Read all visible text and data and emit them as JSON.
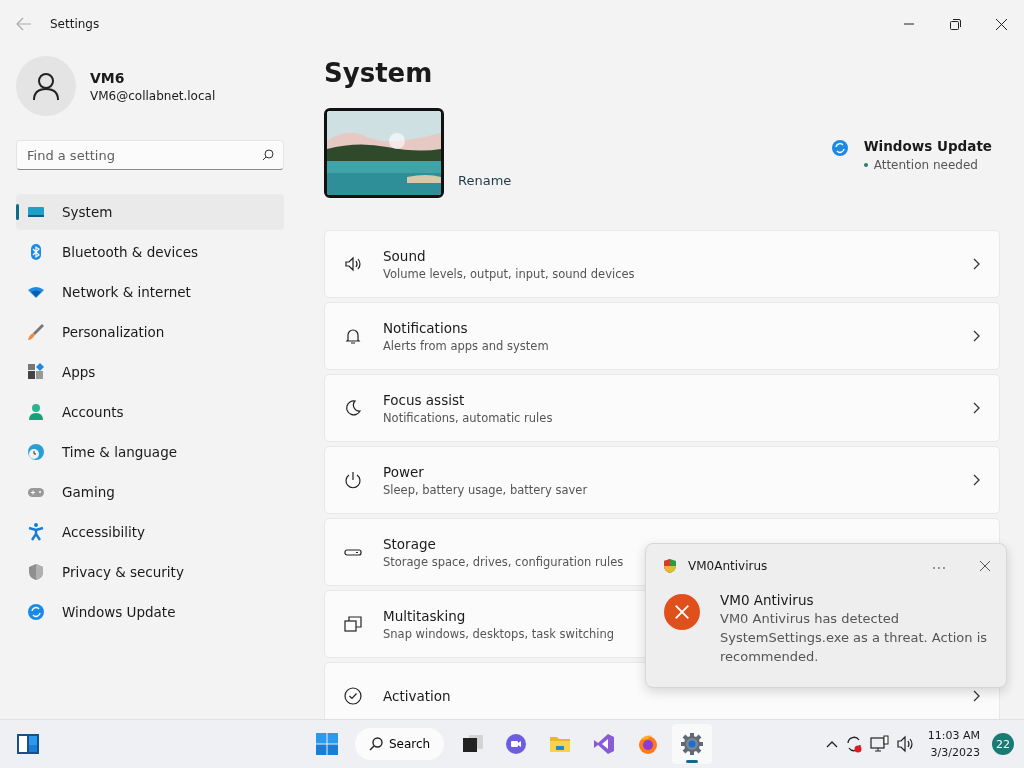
{
  "window": {
    "title": "Settings"
  },
  "profile": {
    "name": "VM6",
    "email": "VM6@collabnet.local"
  },
  "search": {
    "placeholder": "Find a setting"
  },
  "nav": [
    {
      "label": "System",
      "selected": true
    },
    {
      "label": "Bluetooth & devices",
      "selected": false
    },
    {
      "label": "Network & internet",
      "selected": false
    },
    {
      "label": "Personalization",
      "selected": false
    },
    {
      "label": "Apps",
      "selected": false
    },
    {
      "label": "Accounts",
      "selected": false
    },
    {
      "label": "Time & language",
      "selected": false
    },
    {
      "label": "Gaming",
      "selected": false
    },
    {
      "label": "Accessibility",
      "selected": false
    },
    {
      "label": "Privacy & security",
      "selected": false
    },
    {
      "label": "Windows Update",
      "selected": false
    }
  ],
  "page_title": "System",
  "device": {
    "rename": "Rename"
  },
  "windows_update": {
    "title": "Windows Update",
    "status": "Attention needed"
  },
  "settings": [
    {
      "title": "Sound",
      "subtitle": "Volume levels, output, input, sound devices"
    },
    {
      "title": "Notifications",
      "subtitle": "Alerts from apps and system"
    },
    {
      "title": "Focus assist",
      "subtitle": "Notifications, automatic rules"
    },
    {
      "title": "Power",
      "subtitle": "Sleep, battery usage, battery saver"
    },
    {
      "title": "Storage",
      "subtitle": "Storage space, drives, configuration rules"
    },
    {
      "title": "Multitasking",
      "subtitle": "Snap windows, desktops, task switching"
    },
    {
      "title": "Activation"
    }
  ],
  "toast": {
    "app": "VM0Antivirus",
    "title": "VM0 Antivirus",
    "message": "VM0 Antivirus has detected SystemSettings.exe as a threat. Action is recommended."
  },
  "taskbar": {
    "search": "Search",
    "apps": [
      {
        "kind": "taskview",
        "selected": false
      },
      {
        "kind": "chat",
        "selected": false
      },
      {
        "kind": "explorer",
        "selected": false
      },
      {
        "kind": "studio",
        "selected": false
      },
      {
        "kind": "browser",
        "selected": false
      },
      {
        "kind": "settings",
        "selected": true
      }
    ],
    "time": "11:03 AM",
    "date": "3/3/2023",
    "badge": "22"
  }
}
